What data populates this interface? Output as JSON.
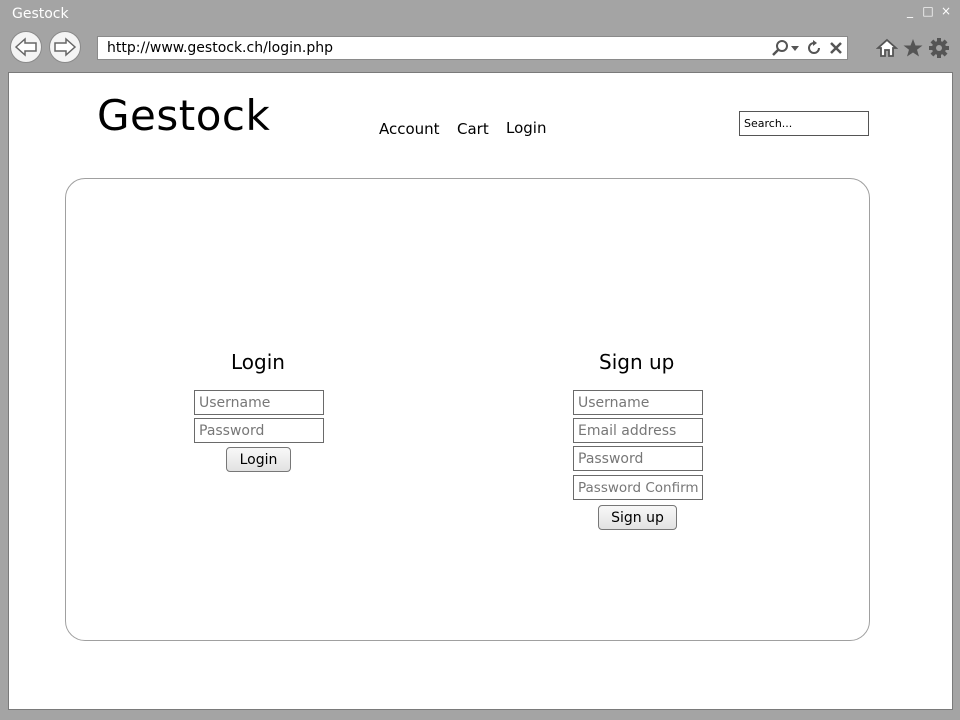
{
  "window": {
    "title": "Gestock",
    "controls": {
      "minimize": "_",
      "maximize": "□",
      "close": "×"
    }
  },
  "browser": {
    "url": "http://www.gestock.ch/login.php",
    "icons": [
      "back-arrow-icon",
      "forward-arrow-icon",
      "search-icon",
      "dropdown-icon",
      "refresh-icon",
      "stop-icon",
      "home-icon",
      "star-icon",
      "gear-icon"
    ]
  },
  "site": {
    "logo": "Gestock",
    "nav": [
      "Account",
      "Cart",
      "Login"
    ],
    "search_placeholder": "Search..."
  },
  "login": {
    "title": "Login",
    "username_placeholder": "Username",
    "password_placeholder": "Password",
    "submit_label": "Login"
  },
  "signup": {
    "title": "Sign up",
    "username_placeholder": "Username",
    "email_placeholder": "Email address",
    "password_placeholder": "Password",
    "password_confirm_placeholder": "Password Confirm",
    "submit_label": "Sign up"
  }
}
